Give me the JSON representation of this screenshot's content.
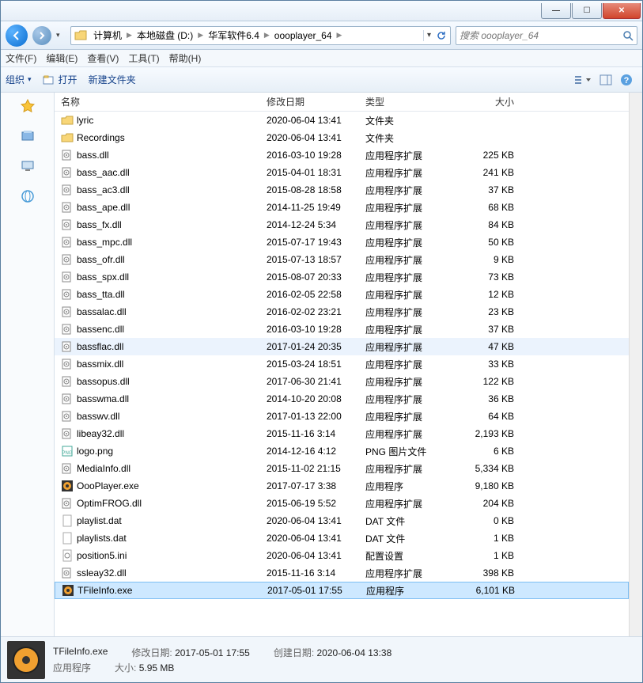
{
  "titlebar": {},
  "win": {
    "min": "—",
    "max": "☐",
    "close": "✕"
  },
  "nav": {
    "dd": "▾"
  },
  "breadcrumbs": [
    "计算机",
    "本地磁盘 (D:)",
    "华军软件6.4",
    "oooplayer_64"
  ],
  "addr_dd": "▾",
  "search": {
    "placeholder": "搜索 oooplayer_64",
    "icon": "🔍"
  },
  "menubar": [
    "文件(F)",
    "编辑(E)",
    "查看(V)",
    "工具(T)",
    "帮助(H)"
  ],
  "toolbar": {
    "organize": "组织",
    "organize_dd": "▾",
    "open": "打开",
    "newfolder": "新建文件夹",
    "view_dd": "▾"
  },
  "columns": {
    "name": "名称",
    "date": "修改日期",
    "type": "类型",
    "size": "大小"
  },
  "files": [
    {
      "icon": "folder",
      "name": "lyric",
      "date": "2020-06-04 13:41",
      "type": "文件夹",
      "size": ""
    },
    {
      "icon": "folder",
      "name": "Recordings",
      "date": "2020-06-04 13:41",
      "type": "文件夹",
      "size": ""
    },
    {
      "icon": "dll",
      "name": "bass.dll",
      "date": "2016-03-10 19:28",
      "type": "应用程序扩展",
      "size": "225 KB"
    },
    {
      "icon": "dll",
      "name": "bass_aac.dll",
      "date": "2015-04-01 18:31",
      "type": "应用程序扩展",
      "size": "241 KB"
    },
    {
      "icon": "dll",
      "name": "bass_ac3.dll",
      "date": "2015-08-28 18:58",
      "type": "应用程序扩展",
      "size": "37 KB"
    },
    {
      "icon": "dll",
      "name": "bass_ape.dll",
      "date": "2014-11-25 19:49",
      "type": "应用程序扩展",
      "size": "68 KB"
    },
    {
      "icon": "dll",
      "name": "bass_fx.dll",
      "date": "2014-12-24 5:34",
      "type": "应用程序扩展",
      "size": "84 KB"
    },
    {
      "icon": "dll",
      "name": "bass_mpc.dll",
      "date": "2015-07-17 19:43",
      "type": "应用程序扩展",
      "size": "50 KB"
    },
    {
      "icon": "dll",
      "name": "bass_ofr.dll",
      "date": "2015-07-13 18:57",
      "type": "应用程序扩展",
      "size": "9 KB"
    },
    {
      "icon": "dll",
      "name": "bass_spx.dll",
      "date": "2015-08-07 20:33",
      "type": "应用程序扩展",
      "size": "73 KB"
    },
    {
      "icon": "dll",
      "name": "bass_tta.dll",
      "date": "2016-02-05 22:58",
      "type": "应用程序扩展",
      "size": "12 KB"
    },
    {
      "icon": "dll",
      "name": "bassalac.dll",
      "date": "2016-02-02 23:21",
      "type": "应用程序扩展",
      "size": "23 KB"
    },
    {
      "icon": "dll",
      "name": "bassenc.dll",
      "date": "2016-03-10 19:28",
      "type": "应用程序扩展",
      "size": "37 KB"
    },
    {
      "icon": "dll",
      "name": "bassflac.dll",
      "date": "2017-01-24 20:35",
      "type": "应用程序扩展",
      "size": "47 KB",
      "hover": true
    },
    {
      "icon": "dll",
      "name": "bassmix.dll",
      "date": "2015-03-24 18:51",
      "type": "应用程序扩展",
      "size": "33 KB"
    },
    {
      "icon": "dll",
      "name": "bassopus.dll",
      "date": "2017-06-30 21:41",
      "type": "应用程序扩展",
      "size": "122 KB"
    },
    {
      "icon": "dll",
      "name": "basswma.dll",
      "date": "2014-10-20 20:08",
      "type": "应用程序扩展",
      "size": "36 KB"
    },
    {
      "icon": "dll",
      "name": "basswv.dll",
      "date": "2017-01-13 22:00",
      "type": "应用程序扩展",
      "size": "64 KB"
    },
    {
      "icon": "dll",
      "name": "libeay32.dll",
      "date": "2015-11-16 3:14",
      "type": "应用程序扩展",
      "size": "2,193 KB"
    },
    {
      "icon": "png",
      "name": "logo.png",
      "date": "2014-12-16 4:12",
      "type": "PNG 图片文件",
      "size": "6 KB"
    },
    {
      "icon": "dll",
      "name": "MediaInfo.dll",
      "date": "2015-11-02 21:15",
      "type": "应用程序扩展",
      "size": "5,334 KB"
    },
    {
      "icon": "exe-ooo",
      "name": "OooPlayer.exe",
      "date": "2017-07-17 3:38",
      "type": "应用程序",
      "size": "9,180 KB"
    },
    {
      "icon": "dll",
      "name": "OptimFROG.dll",
      "date": "2015-06-19 5:52",
      "type": "应用程序扩展",
      "size": "204 KB"
    },
    {
      "icon": "dat",
      "name": "playlist.dat",
      "date": "2020-06-04 13:41",
      "type": "DAT 文件",
      "size": "0 KB"
    },
    {
      "icon": "dat",
      "name": "playlists.dat",
      "date": "2020-06-04 13:41",
      "type": "DAT 文件",
      "size": "1 KB"
    },
    {
      "icon": "ini",
      "name": "position5.ini",
      "date": "2020-06-04 13:41",
      "type": "配置设置",
      "size": "1 KB"
    },
    {
      "icon": "dll",
      "name": "ssleay32.dll",
      "date": "2015-11-16 3:14",
      "type": "应用程序扩展",
      "size": "398 KB"
    },
    {
      "icon": "exe-ooo",
      "name": "TFileInfo.exe",
      "date": "2017-05-01 17:55",
      "type": "应用程序",
      "size": "6,101 KB",
      "selected": true
    }
  ],
  "details": {
    "filename": "TFileInfo.exe",
    "filetype": "应用程序",
    "mod_label": "修改日期:",
    "mod_value": "2017-05-01 17:55",
    "create_label": "创建日期:",
    "create_value": "2020-06-04 13:38",
    "size_label": "大小:",
    "size_value": "5.95 MB"
  }
}
